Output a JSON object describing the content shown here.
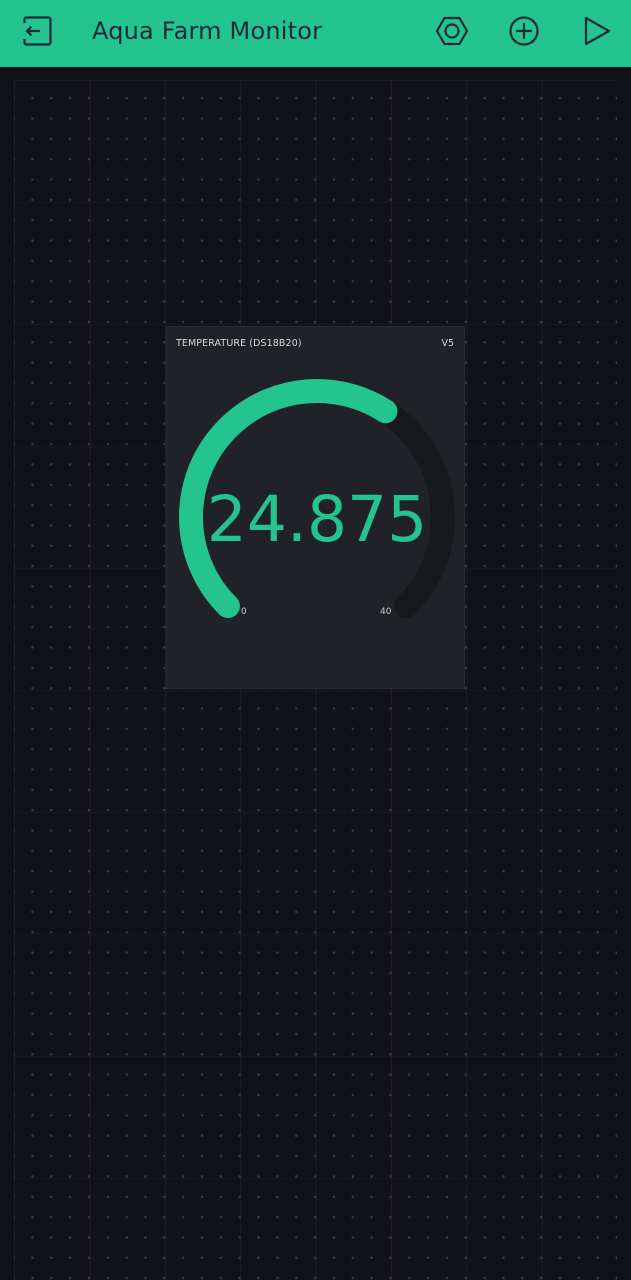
{
  "header": {
    "title": "Aqua Farm Monitor",
    "background_color": "#23c48e",
    "icons": [
      "exit-icon",
      "settings-hexagon-icon",
      "add-circle-icon",
      "play-icon"
    ]
  },
  "widget": {
    "title": "TEMPERATURE (DS18B20)",
    "pin": "V5",
    "value": "24.875",
    "min_label": "0",
    "max_label": "40",
    "min": 0,
    "max": 40,
    "current": 24.875,
    "accent_color": "#23c48e",
    "track_color": "#18191d"
  }
}
